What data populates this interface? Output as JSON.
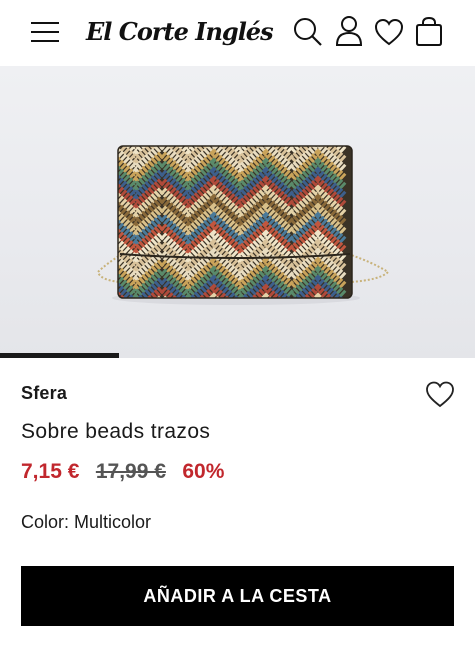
{
  "header": {
    "logo_text": "El Corte Inglés",
    "icons": [
      "menu-icon",
      "search-icon",
      "user-icon",
      "heart-icon",
      "shopping-bag-icon"
    ]
  },
  "gallery": {
    "image_index_fraction": 0.25
  },
  "product": {
    "brand": "Sfera",
    "name": "Sobre beads trazos",
    "price_current": "7,15 €",
    "price_old": "17,99 €",
    "discount": "60%",
    "color_label": "Color: Multicolor",
    "add_to_cart": "AÑADIR A LA CESTA"
  },
  "colors": {
    "accent_red": "#c1272d",
    "button_bg": "#000000",
    "text": "#1a1a1a"
  }
}
